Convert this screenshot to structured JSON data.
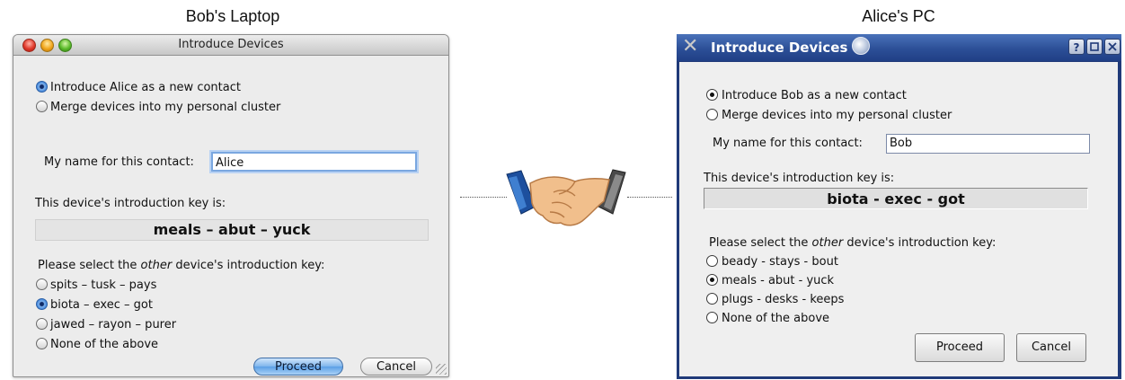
{
  "captions": {
    "left": "Bob's Laptop",
    "right": "Alice's PC"
  },
  "mac_window": {
    "title": "Introduce Devices",
    "mode_options": [
      "Introduce Alice as a new contact",
      "Merge devices into my personal cluster"
    ],
    "mode_selected": 0,
    "name_label": "My name for this contact:",
    "name_value": "Alice",
    "key_label": "This device's introduction key is:",
    "key_value": "meals – abut – yuck",
    "select_label_pre": "Please select the ",
    "select_label_em": "other",
    "select_label_post": " device's introduction key:",
    "key_options": [
      "spits – tusk – pays",
      "biota – exec – got",
      "jawed – rayon – purer",
      "None of the above"
    ],
    "key_selected": 1,
    "proceed_label": "Proceed",
    "cancel_label": "Cancel"
  },
  "kde_window": {
    "title": "Introduce Devices",
    "help_glyph": "?",
    "mode_options": [
      "Introduce Bob as a new contact",
      "Merge devices into my personal cluster"
    ],
    "mode_selected": 0,
    "name_label": "My name for this contact:",
    "name_value": "Bob",
    "key_label": "This device's introduction key is:",
    "key_value": "biota - exec - got",
    "select_label_pre": "Please select the ",
    "select_label_em": "other",
    "select_label_post": " device's introduction key:",
    "key_options": [
      "beady - stays - bout",
      "meals - abut - yuck",
      "plugs - desks - keeps",
      "None of the above"
    ],
    "key_selected": 1,
    "proceed_label": "Proceed",
    "cancel_label": "Cancel"
  },
  "colors": {
    "mac_accent": "#5b9fe6",
    "kde_titlebar": "#2c4f97"
  }
}
